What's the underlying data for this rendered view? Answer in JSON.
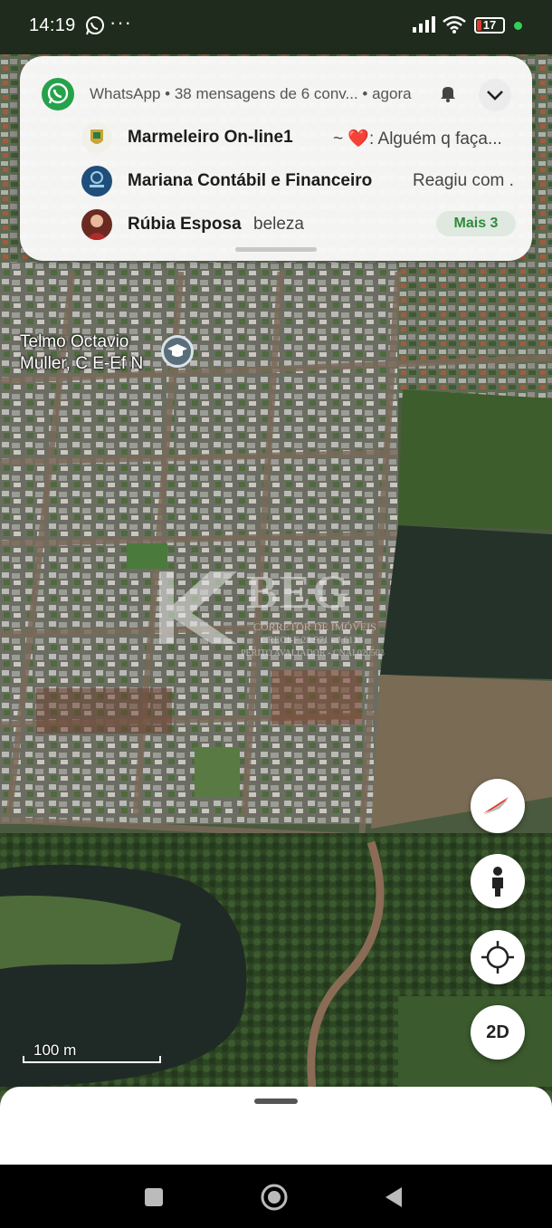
{
  "status_bar": {
    "time": "14:19",
    "more": "···",
    "battery": "17",
    "battery_level": 0.17,
    "battery_color": "#e03a2e"
  },
  "notification": {
    "app_name": "WhatsApp",
    "header": "WhatsApp • 38 mensagens de 6 conv... • agora",
    "accent": "#25a24a",
    "messages": [
      {
        "sender": "Marmeleiro On-line1",
        "text": "~ ❤️: Alguém q faça..."
      },
      {
        "sender": "Mariana Contábil e Financeiro",
        "text": "Reagiu com ..."
      },
      {
        "sender": "Rúbia Esposa",
        "text": "beleza"
      }
    ],
    "more_label": "Mais 3"
  },
  "map": {
    "poi_label": "Telmo Octavio\nMuller, C E-Ef N",
    "watermark": {
      "brand": "BEG",
      "line1": "CORRETOR DE IMÓVEIS",
      "line2": "CRECI-F 28.971 - J 6133",
      "line3": "PERITO AVALIADOR - CNAI 020503"
    },
    "scale_label": "100 m",
    "buttons": {
      "compass": "compass-icon",
      "street_view": "pegman-icon",
      "my_location": "crosshair-icon",
      "mode_label": "2D"
    }
  },
  "nav_bar": {
    "recents": "square-icon",
    "home": "circle-icon",
    "back": "triangle-back-icon"
  }
}
